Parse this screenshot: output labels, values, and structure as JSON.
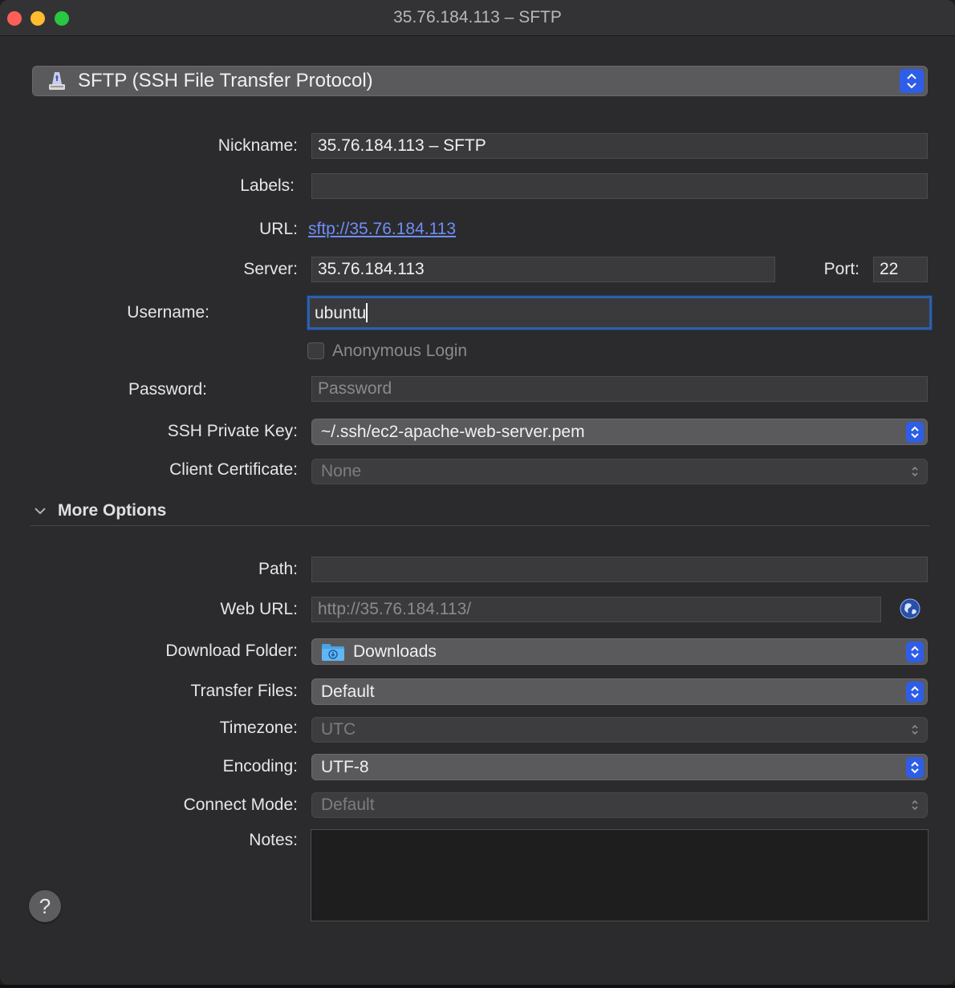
{
  "window": {
    "title": "35.76.184.113 – SFTP"
  },
  "protocol": {
    "label": "SFTP (SSH File Transfer Protocol)"
  },
  "fields": {
    "nickname": {
      "label": "Nickname:",
      "value": "35.76.184.113 – SFTP"
    },
    "labels": {
      "label": "Labels:",
      "value": ""
    },
    "url": {
      "label": "URL:",
      "value": "sftp://35.76.184.113"
    },
    "server": {
      "label": "Server:",
      "value": "35.76.184.113"
    },
    "port": {
      "label": "Port:",
      "value": "22"
    },
    "username": {
      "label": "Username:",
      "value": "ubuntu"
    },
    "anonymous": {
      "label": "Anonymous Login",
      "checked": false
    },
    "password": {
      "label": "Password:",
      "placeholder": "Password"
    },
    "ssh_key": {
      "label": "SSH Private Key:",
      "value": "~/.ssh/ec2-apache-web-server.pem"
    },
    "client_cert": {
      "label": "Client Certificate:",
      "value": "None"
    }
  },
  "more_options": {
    "label": "More Options",
    "path": {
      "label": "Path:",
      "value": ""
    },
    "web_url": {
      "label": "Web URL:",
      "placeholder": "http://35.76.184.113/"
    },
    "download_folder": {
      "label": "Download Folder:",
      "value": "Downloads"
    },
    "transfer_files": {
      "label": "Transfer Files:",
      "value": "Default"
    },
    "timezone": {
      "label": "Timezone:",
      "value": "UTC"
    },
    "encoding": {
      "label": "Encoding:",
      "value": "UTF-8"
    },
    "connect_mode": {
      "label": "Connect Mode:",
      "value": "Default"
    },
    "notes": {
      "label": "Notes:",
      "value": ""
    }
  },
  "help": {
    "label": "?"
  },
  "colors": {
    "accent": "#2e5ee8",
    "link": "#6f8ef7",
    "focus_ring": "#2f5fa8"
  },
  "icons": [
    "disk-icon",
    "stepper-icon",
    "chevron-down-icon",
    "globe-icon",
    "folder-icon",
    "help-icon"
  ]
}
